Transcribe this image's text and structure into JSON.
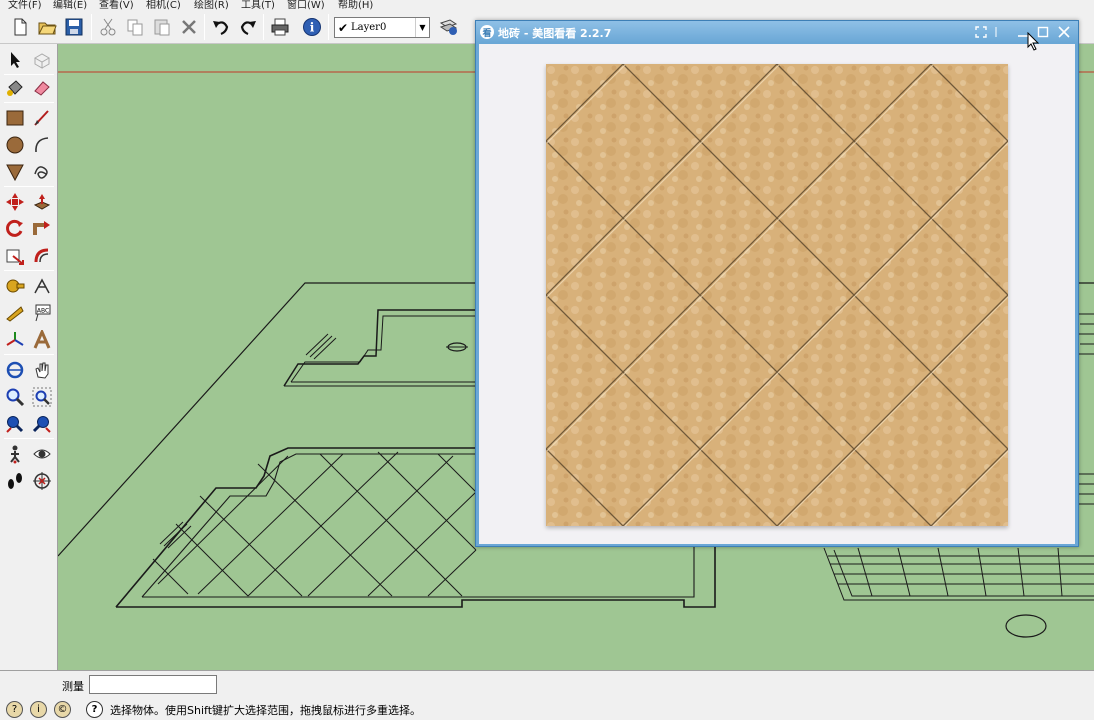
{
  "menubar": {
    "items": [
      {
        "label": "文件(F)"
      },
      {
        "label": "编辑(E)"
      },
      {
        "label": "查看(V)"
      },
      {
        "label": "相机(C)"
      },
      {
        "label": "绘图(R)"
      },
      {
        "label": "工具(T)"
      },
      {
        "label": "窗口(W)"
      },
      {
        "label": "帮助(H)"
      }
    ]
  },
  "toolbar": {
    "layer": "Layer0",
    "buttons": [
      "new-icon",
      "open-icon",
      "save-icon",
      "cut-icon",
      "copy-icon",
      "paste-icon",
      "erase-icon",
      "undo-icon",
      "redo-icon",
      "print-icon",
      "info-icon",
      "layer-manager-icon"
    ]
  },
  "palette": {
    "tools": [
      "select-icon",
      "make-component-icon",
      "paint-bucket-icon",
      "eraser-icon",
      "rectangle-icon",
      "line-icon",
      "circle-icon",
      "arc-icon",
      "polygon-icon",
      "freehand-icon",
      "move-icon",
      "push-pull-icon",
      "rotate-icon",
      "follow-me-icon",
      "scale-icon",
      "offset-icon",
      "tape-measure-icon",
      "dimension-icon",
      "protractor-icon",
      "text-icon",
      "axes-icon",
      "3d-text-icon",
      "orbit-icon",
      "pan-icon",
      "zoom-icon",
      "zoom-window-icon",
      "zoom-extents-icon",
      "previous-view-icon",
      "position-camera-icon",
      "look-around-icon",
      "walk-icon",
      "section-plane-icon"
    ]
  },
  "viewer": {
    "title": "地砖 - 美图看看 2.2.7",
    "app_icon": "看",
    "colors": {
      "titlebar": "#6aa7d6",
      "body": "#f2f1f4",
      "tile": "#d9b27a"
    }
  },
  "measure": {
    "label": "测量",
    "value": ""
  },
  "status": {
    "text": "选择物体。使用Shift键扩大选择范围，拖拽鼠标进行多重选择。",
    "help_icon": "?"
  },
  "colors": {
    "viewport": "#9fc693",
    "red_axis": "#c0392b",
    "lines": "#1a1a1a"
  }
}
